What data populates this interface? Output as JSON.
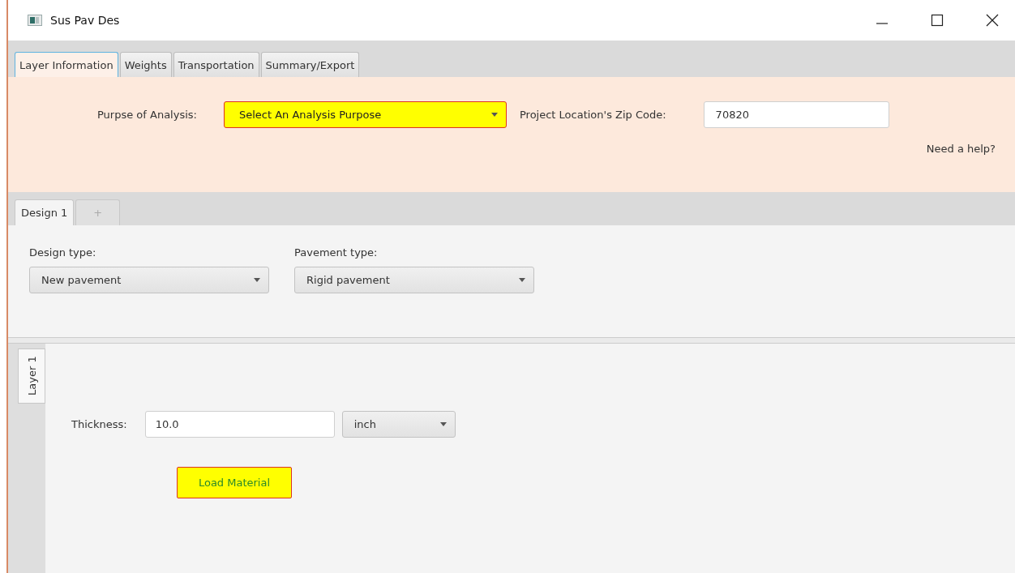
{
  "window": {
    "title": "Sus Pav Des"
  },
  "tabs": [
    {
      "label": "Layer Information",
      "selected": true
    },
    {
      "label": "Weights",
      "selected": false
    },
    {
      "label": "Transportation",
      "selected": false
    },
    {
      "label": "Summary/Export",
      "selected": false
    }
  ],
  "analysis": {
    "purpose_label": "Purpse of Analysis:",
    "purpose_value": "Select An Analysis Purpose",
    "zip_label": "Project Location's Zip Code:",
    "zip_value": "70820",
    "help_link": "Need a help?"
  },
  "design_tabs": [
    {
      "label": "Design 1",
      "selected": true
    },
    {
      "label": "+",
      "selected": false
    }
  ],
  "design": {
    "design_type_label": "Design type:",
    "design_type_value": "New pavement",
    "pavement_type_label": "Pavement type:",
    "pavement_type_value": "Rigid pavement"
  },
  "layer_tabs": [
    {
      "label": "Layer 1",
      "selected": true
    }
  ],
  "layer": {
    "thickness_label": "Thickness:",
    "thickness_value": "10.0",
    "unit_value": "inch",
    "load_button": "Load Material"
  }
}
